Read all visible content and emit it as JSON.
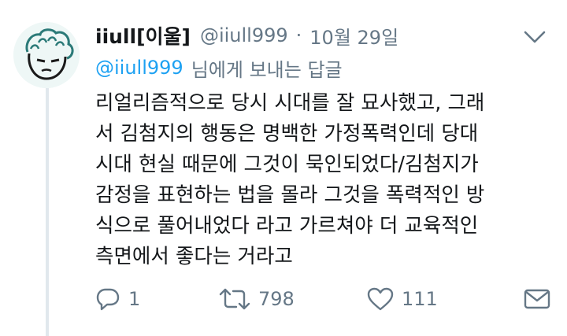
{
  "tweet": {
    "display_name": "iiull[이울]",
    "handle": "@iiull999",
    "separator": "·",
    "date": "10월 29일",
    "reply_to_handle": "@iiull999",
    "reply_to_suffix": "님에게 보내는 답글",
    "lines": [
      "리얼리즘적으로 당시 시대를 잘 묘사했고, 그래",
      "서 김첨지의 행동은 명백한 가정폭력인데 당대",
      "시대 현실 때문에 그것이 묵인되었다/김첨지가",
      "감정을 표현하는 법을 몰라 그것을 폭력적인 방",
      "식으로 풀어내었다 라고 가르쳐야 더 교육적인",
      "측면에서 좋다는 거라고"
    ]
  },
  "actions": {
    "reply_count": "1",
    "retweet_count": "798",
    "like_count": "111"
  },
  "icons": [
    "reply-icon",
    "retweet-icon",
    "heart-icon",
    "envelope-icon",
    "chevron-down-icon"
  ],
  "colors": {
    "link": "#1da1f2",
    "muted": "#657786",
    "text": "#14171a",
    "thread_line": "#e1e8ed"
  }
}
